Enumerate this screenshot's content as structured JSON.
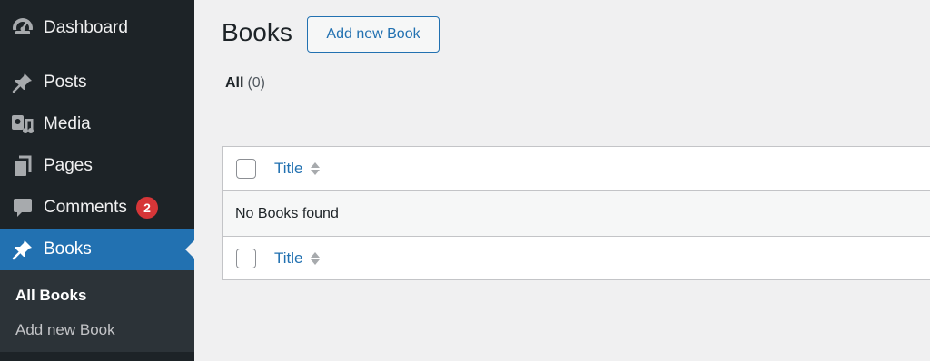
{
  "sidebar": {
    "items": [
      {
        "label": "Dashboard",
        "icon": "dashboard-icon"
      },
      {
        "label": "Posts",
        "icon": "pushpin-icon"
      },
      {
        "label": "Media",
        "icon": "media-icon"
      },
      {
        "label": "Pages",
        "icon": "pages-icon"
      },
      {
        "label": "Comments",
        "icon": "comment-icon",
        "badge": "2"
      },
      {
        "label": "Books",
        "icon": "pushpin-icon",
        "active": true
      }
    ],
    "submenu": [
      {
        "label": "All Books",
        "current": true
      },
      {
        "label": "Add new Book",
        "current": false
      }
    ]
  },
  "header": {
    "title": "Books",
    "add_new_label": "Add new Book"
  },
  "filters": {
    "all_label": "All",
    "all_count": "(0)"
  },
  "table": {
    "column_title": "Title",
    "empty_message": "No Books found"
  },
  "colors": {
    "sidebar_bg": "#1d2327",
    "submenu_bg": "#2c3338",
    "accent": "#2271b1",
    "badge": "#d63638",
    "page_bg": "#f0f0f1"
  }
}
